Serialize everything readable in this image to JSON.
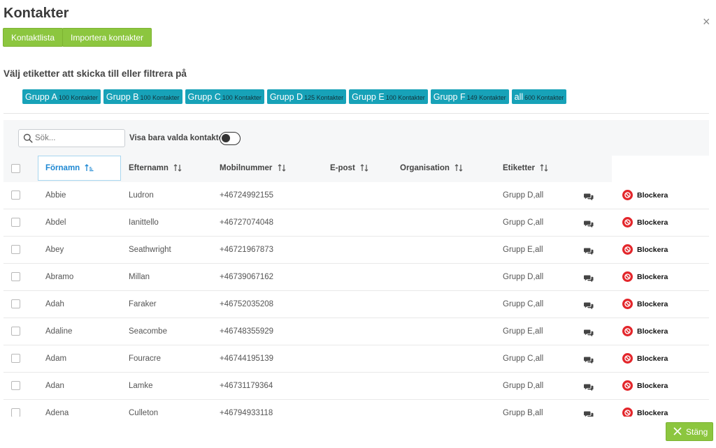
{
  "header": {
    "title": "Kontakter",
    "close_symbol": "×"
  },
  "toolbar": {
    "contact_list_label": "Kontaktlista",
    "import_label": "Importera kontakter"
  },
  "filter": {
    "label": "Välj etiketter att skicka till eller filtrera på",
    "tags": [
      {
        "name": "Grupp A",
        "count": "100 Kontakter"
      },
      {
        "name": "Grupp B",
        "count": "100 Kontakter"
      },
      {
        "name": "Grupp C",
        "count": "100 Kontakter"
      },
      {
        "name": "Grupp D",
        "count": "125 Kontakter"
      },
      {
        "name": "Grupp E",
        "count": "100 Kontakter"
      },
      {
        "name": "Grupp F",
        "count": "149 Kontakter"
      },
      {
        "name": "all",
        "count": "600 Kontakter"
      }
    ]
  },
  "search": {
    "placeholder": "Sök...",
    "value": ""
  },
  "toggle": {
    "label": "Visa bara valda kontakter",
    "on": false
  },
  "table": {
    "columns": [
      "Förnamn",
      "Efternamn",
      "Mobilnummer",
      "E-post",
      "Organisation",
      "Etiketter"
    ],
    "active_sort": "Förnamn",
    "block_label": "Blockera",
    "rows": [
      {
        "first": "Abbie",
        "last": "Ludron",
        "phone": "+46724992155",
        "email": "",
        "org": "",
        "tags": "Grupp D,all"
      },
      {
        "first": "Abdel",
        "last": "Ianittello",
        "phone": "+46727074048",
        "email": "",
        "org": "",
        "tags": "Grupp C,all"
      },
      {
        "first": "Abey",
        "last": "Seathwright",
        "phone": "+46721967873",
        "email": "",
        "org": "",
        "tags": "Grupp E,all"
      },
      {
        "first": "Abramo",
        "last": "Millan",
        "phone": "+46739067162",
        "email": "",
        "org": "",
        "tags": "Grupp D,all"
      },
      {
        "first": "Adah",
        "last": "Faraker",
        "phone": "+46752035208",
        "email": "",
        "org": "",
        "tags": "Grupp C,all"
      },
      {
        "first": "Adaline",
        "last": "Seacombe",
        "phone": "+46748355929",
        "email": "",
        "org": "",
        "tags": "Grupp E,all"
      },
      {
        "first": "Adam",
        "last": "Fouracre",
        "phone": "+46744195139",
        "email": "",
        "org": "",
        "tags": "Grupp C,all"
      },
      {
        "first": "Adan",
        "last": "Lamke",
        "phone": "+46731179364",
        "email": "",
        "org": "",
        "tags": "Grupp D,all"
      },
      {
        "first": "Adena",
        "last": "Culleton",
        "phone": "+46794933118",
        "email": "",
        "org": "",
        "tags": "Grupp B,all"
      }
    ]
  },
  "footer": {
    "close_label": "Stäng"
  },
  "colors": {
    "primary_green": "#8cc63f",
    "tag_teal": "#17a2b8",
    "block_red": "#e3262b",
    "sort_active": "#1e88d3"
  }
}
